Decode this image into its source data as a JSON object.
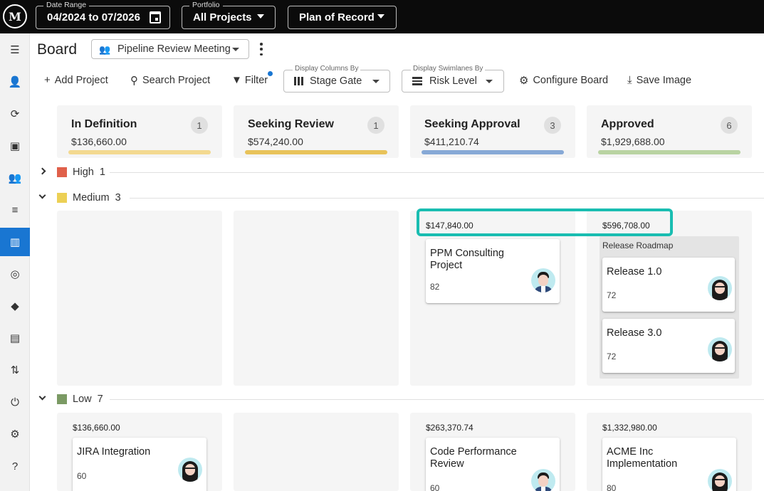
{
  "topbar": {
    "logo_text": "M",
    "date_range": {
      "legend": "Date Range",
      "value": "04/2024 to 07/2026"
    },
    "portfolio": {
      "legend": "Portfolio",
      "value": "All Projects"
    },
    "plan": {
      "value": "Plan of Record"
    }
  },
  "sidebar": {
    "items": [
      {
        "name": "menu-icon",
        "glyph": "☰"
      },
      {
        "name": "user-list-icon",
        "glyph": "👤"
      },
      {
        "name": "refresh-icon",
        "glyph": "⟳"
      },
      {
        "name": "badge-icon",
        "glyph": "▣"
      },
      {
        "name": "people-icon",
        "glyph": "👥"
      },
      {
        "name": "list-icon",
        "glyph": "≡"
      },
      {
        "name": "board-icon",
        "glyph": "▥",
        "active": true
      },
      {
        "name": "target-icon",
        "glyph": "◎"
      },
      {
        "name": "directions-icon",
        "glyph": "◆"
      },
      {
        "name": "document-icon",
        "glyph": "▤"
      },
      {
        "name": "sort-arrows-icon",
        "glyph": "⇅"
      },
      {
        "name": "plug-icon",
        "glyph": "⏻"
      },
      {
        "name": "settings-icon",
        "glyph": "⚙"
      },
      {
        "name": "help-icon",
        "glyph": "?"
      }
    ]
  },
  "header": {
    "title": "Board",
    "view_select": "Pipeline Review Meeting"
  },
  "toolbar": {
    "add_project": "Add Project",
    "search_project": "Search Project",
    "filter": "Filter",
    "columns_by": {
      "legend": "Display Columns By",
      "value": "Stage Gate"
    },
    "swimlanes_by": {
      "legend": "Display Swimlanes By",
      "value": "Risk Level"
    },
    "configure_board": "Configure Board",
    "save_image": "Save Image"
  },
  "columns": [
    {
      "title": "In Definition",
      "total": "$136,660.00",
      "count": "1",
      "color": "#f3d990"
    },
    {
      "title": "Seeking Review",
      "total": "$574,240.00",
      "count": "1",
      "color": "#e8c35a"
    },
    {
      "title": "Seeking Approval",
      "total": "$411,210.74",
      "count": "3",
      "color": "#87a9d6"
    },
    {
      "title": "Approved",
      "total": "$1,929,688.00",
      "count": "6",
      "color": "#b9d3a2"
    }
  ],
  "swimlanes": [
    {
      "name": "High",
      "count": "1",
      "color": "#e0604a",
      "expanded": false
    },
    {
      "name": "Medium",
      "count": "3",
      "color": "#ecd055",
      "expanded": true
    },
    {
      "name": "Low",
      "count": "7",
      "color": "#7b9a64",
      "expanded": true
    }
  ],
  "medium": {
    "approval_total": "$147,840.00",
    "approved_total": "$596,708.00",
    "ppm_card": {
      "title": "PPM Consulting Project",
      "number": "82"
    },
    "group_label": "Release Roadmap",
    "release_1": {
      "title": "Release 1.0",
      "number": "72"
    },
    "release_3": {
      "title": "Release 3.0",
      "number": "72"
    }
  },
  "low": {
    "definition_total": "$136,660.00",
    "approval_total": "$263,370.74",
    "approved_total": "$1,332,980.00",
    "jira_card": {
      "title": "JIRA Integration",
      "number": "60"
    },
    "code_card": {
      "title": "Code Performance Review",
      "number": "60"
    },
    "acme_card": {
      "title": "ACME Inc Implementation",
      "number": "80"
    }
  },
  "colors": {
    "accent": "#1976d2",
    "highlight": "#19bdb1"
  }
}
